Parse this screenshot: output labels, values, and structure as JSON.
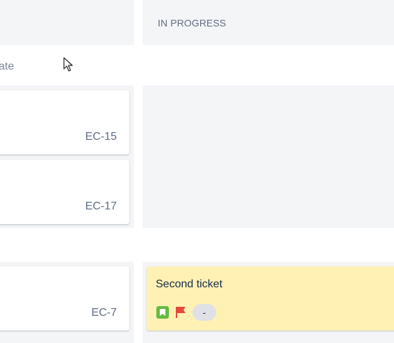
{
  "columns": {
    "in_progress_title": "IN PROGRESS"
  },
  "swimlane": {
    "label": "ate"
  },
  "todo_cards": [
    {
      "key": "EC-15"
    },
    {
      "key": "EC-17"
    },
    {
      "key": "EC-7"
    }
  ],
  "in_progress_card": {
    "summary": "Second ticket",
    "estimate": "-",
    "issue_type_icon": "story-icon",
    "flag_icon": "flag-icon"
  },
  "colors": {
    "column_bg": "#f4f5f7",
    "flagged_card_bg": "#fef1b3",
    "story_green": "#65ba43",
    "flag_red": "#e5493a",
    "key_text": "#5e6c84"
  }
}
